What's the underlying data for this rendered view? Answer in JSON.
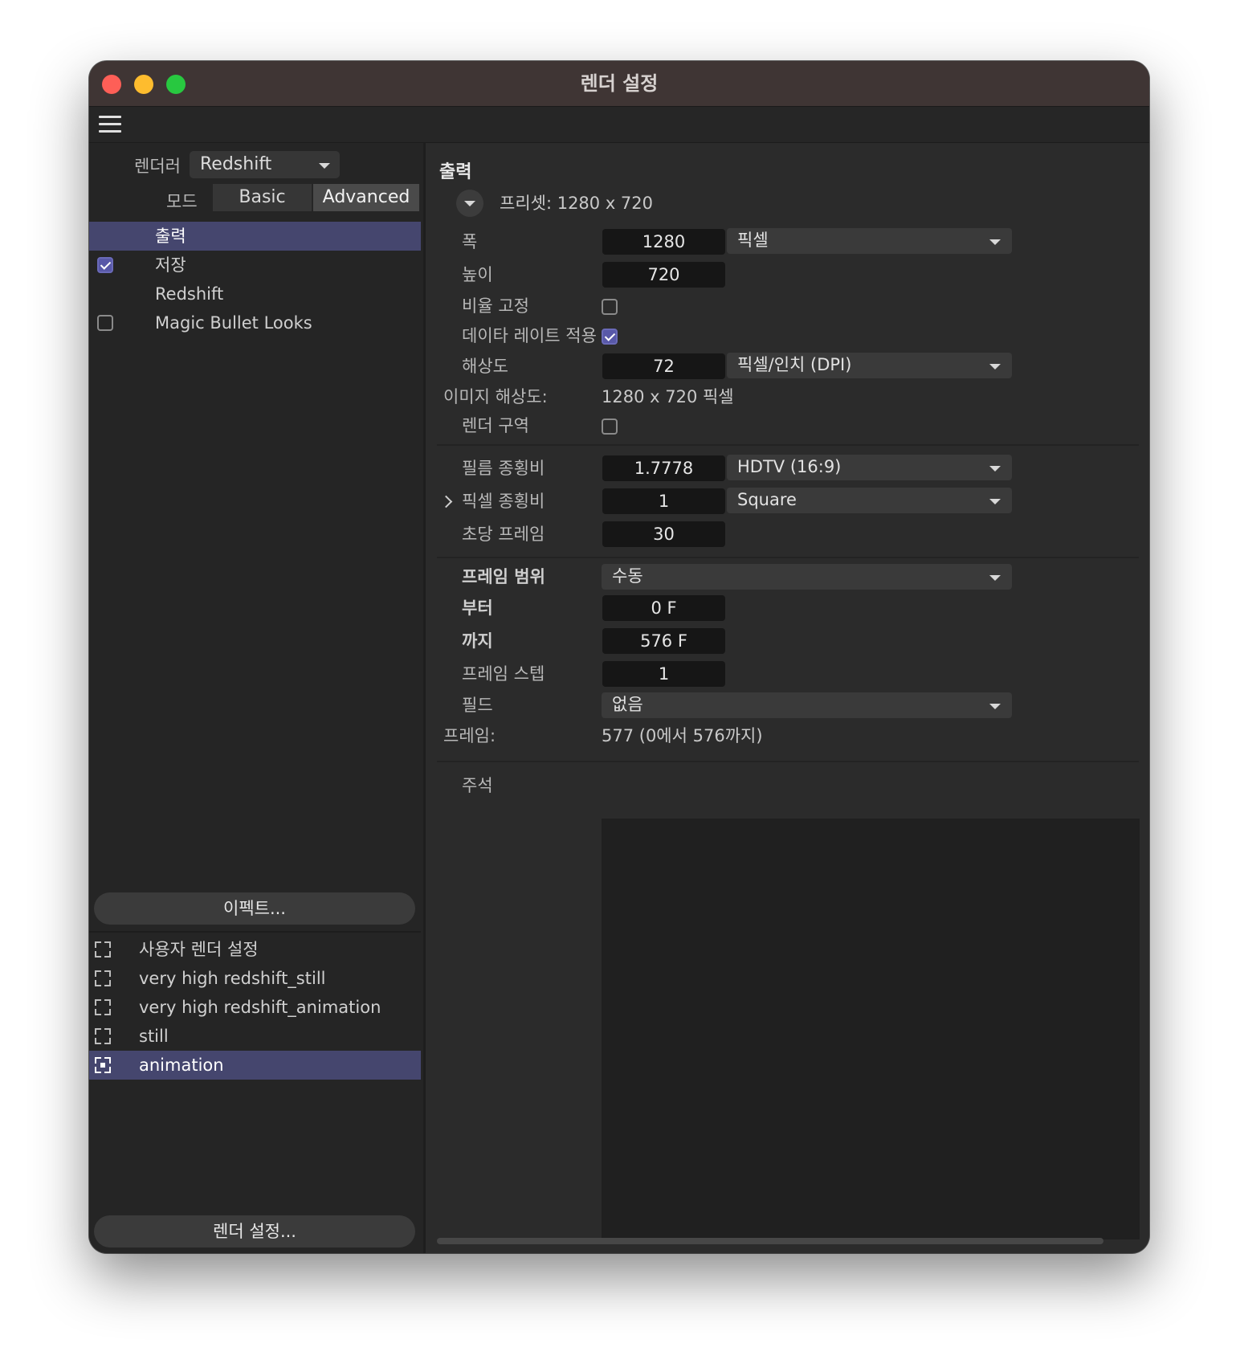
{
  "window": {
    "title": "렌더 설정"
  },
  "left": {
    "renderer_label": "렌더러",
    "renderer_value": "Redshift",
    "mode_label": "모드",
    "modes": [
      "Basic",
      "Advanced"
    ],
    "active_mode": "Advanced",
    "tree": [
      {
        "label": "출력",
        "checkbox": "none",
        "selected": true
      },
      {
        "label": "저장",
        "checkbox": "checked",
        "selected": false
      },
      {
        "label": "Redshift",
        "checkbox": "none",
        "selected": false
      },
      {
        "label": "Magic Bullet Looks",
        "checkbox": "unchecked",
        "selected": false
      }
    ],
    "effects_button": "이펙트...",
    "presets": [
      {
        "label": "사용자 렌더 설정",
        "selected": false
      },
      {
        "label": "very high redshift_still",
        "selected": false
      },
      {
        "label": "very high redshift_animation",
        "selected": false
      },
      {
        "label": "still",
        "selected": false
      },
      {
        "label": "animation",
        "selected": true
      }
    ],
    "render_settings_button": "렌더 설정..."
  },
  "output": {
    "section_title": "출력",
    "preset_text": "프리셋: 1280 x 720",
    "width_label": "폭",
    "width_value": "1280",
    "width_unit": "픽셀",
    "height_label": "높이",
    "height_value": "720",
    "lock_ratio_label": "비율 고정",
    "lock_ratio_checked": false,
    "adapt_rate_label": "데이타 레이트 적용",
    "adapt_rate_checked": true,
    "resolution_label": "해상도",
    "resolution_value": "72",
    "resolution_unit": "픽셀/인치 (DPI)",
    "image_resolution_label": "이미지 해상도:",
    "image_resolution_value": "1280 x 720 픽셀",
    "render_region_label": "렌더 구역",
    "render_region_checked": false,
    "film_aspect_label": "필름 종횡비",
    "film_aspect_value": "1.7778",
    "film_aspect_preset": "HDTV (16:9)",
    "pixel_aspect_label": "픽셀 종횡비",
    "pixel_aspect_value": "1",
    "pixel_aspect_preset": "Square",
    "fps_label": "초당 프레임",
    "fps_value": "30",
    "frame_range_label": "프레임 범위",
    "frame_range_value": "수동",
    "from_label": "부터",
    "from_value": "0 F",
    "to_label": "까지",
    "to_value": "576 F",
    "frame_step_label": "프레임 스텝",
    "frame_step_value": "1",
    "field_label": "필드",
    "field_value": "없음",
    "frames_label": "프레임:",
    "frames_value": "577 (0에서 576까지)",
    "notes_label": "주석",
    "notes_value": ""
  },
  "colors": {
    "selection": "#45466e",
    "checkbox_checked": "#5858a8"
  }
}
